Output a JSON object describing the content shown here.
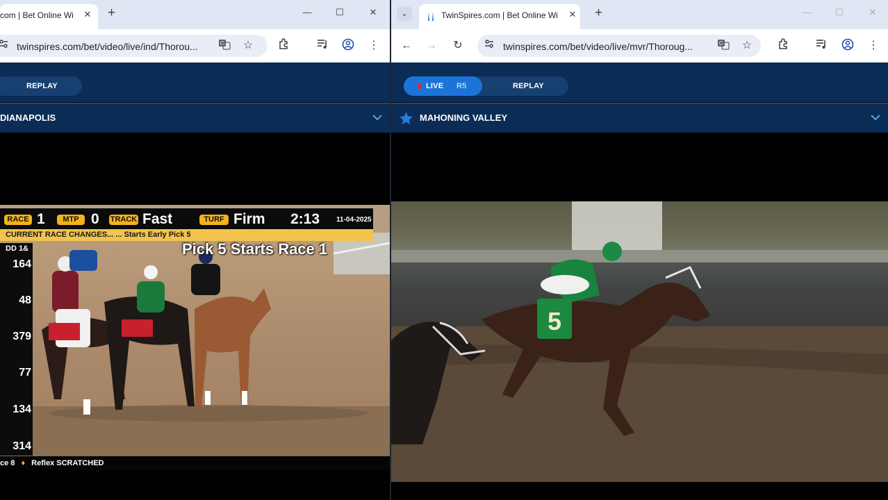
{
  "left_window": {
    "tab_title": "com | Bet Online Wi",
    "url": "twinspires.com/bet/video/live/ind/Thorou...",
    "nav": {
      "replay_label": "REPLAY"
    },
    "track_name": "DIANAPOLIS",
    "video": {
      "race_label": "RACE",
      "race_value": "1",
      "mtp_label": "MTP",
      "mtp_value": "0",
      "track_label": "TRACK",
      "track_value": "Fast",
      "turf_label": "TURF",
      "turf_value": "Firm",
      "post_time": "2:13",
      "date": "11-04-2025",
      "ticker_text": "CURRENT RACE CHANGES...   ... Starts Early Pick 5",
      "banner_text": "Pick 5 Starts Race 1",
      "odds_header": "DD 1&",
      "odds": [
        "164",
        "48",
        "379",
        "77",
        "134",
        "314"
      ],
      "bottom_ticker_prefix": "ce 8",
      "bottom_ticker_text": "Reflex  SCRATCHED"
    }
  },
  "right_window": {
    "tab_title": "TwinSpires.com | Bet Online Wi",
    "url": "twinspires.com/bet/video/live/mvr/Thoroug...",
    "nav": {
      "live_label": "LIVE",
      "race_label": "R5",
      "replay_label": "REPLAY"
    },
    "track_name": "MAHONING VALLEY",
    "saddle_cloth_number": "5"
  },
  "colors": {
    "site_navy": "#0a2c55",
    "live_blue": "#1c74d8",
    "hud_yellow": "#f3b21d",
    "live_red": "#e5252a"
  },
  "icons": [
    "translate-icon",
    "star-icon",
    "extensions-icon",
    "media-control-icon",
    "profile-icon",
    "menu-kebab-icon",
    "back-icon",
    "forward-icon",
    "reload-icon",
    "site-info-icon",
    "chevron-down-icon",
    "favorite-star-icon",
    "twinspires-logo-icon"
  ]
}
